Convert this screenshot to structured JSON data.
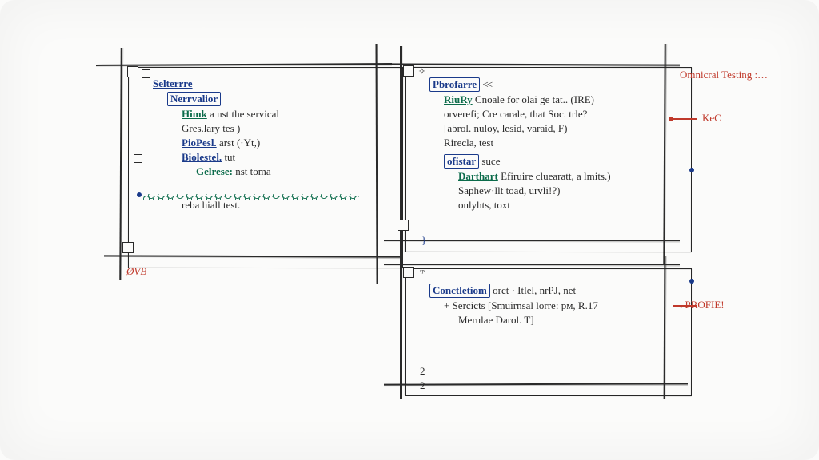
{
  "panelA": {
    "title": "Selterrre",
    "tag": "Nerrvalior",
    "l1_kw": "Himk",
    "l1_txt": "a nst the servical",
    "l2_txt": "Gres.lary tes )",
    "l3_kw": "PioPesl.",
    "l3_txt": "arst (·Yt,)",
    "l4_kw": "Biolestel.",
    "l4_txt": "tut",
    "l5_kw": "Gelrese:",
    "l5_txt": "nst toma",
    "footer": "reba hiall test."
  },
  "panelB": {
    "title": "Pbrofarre",
    "arrows": "<<",
    "l1_kw": "RiuRy",
    "l1_txt": "Cnoale for olai ge tat.. (IRE)",
    "l2_txt": "orverefi; Cre carale, that Soc. trle?",
    "l3_txt": "[abrol. nuloy, lesid, varaid, F)",
    "l4_txt": "Rirecla, test",
    "tag2": "ofistar",
    "tag2_txt": "suce",
    "l5_kw": "Darthart",
    "l5_txt": "Efiruire cluearatt, a lmits.)",
    "l6_txt": "Saphew·llt toad, urvli!?)",
    "l7_txt": "onlyhts, toxt",
    "brace": "}"
  },
  "panelC": {
    "title": "Conctletiom",
    "title_txt": "orct · Itlel, nrPJ, net",
    "l1_txt": "+  Sercicts  [Smuirnsal lorre: pм, R.17",
    "l2_txt": "Merulae Darol. T]",
    "n1": "2",
    "n2": "2"
  },
  "annotations": {
    "top": "Omnicral Testing :…",
    "mid": "KeC",
    "bot": ". PROFIE!",
    "bl": "ØVB"
  }
}
